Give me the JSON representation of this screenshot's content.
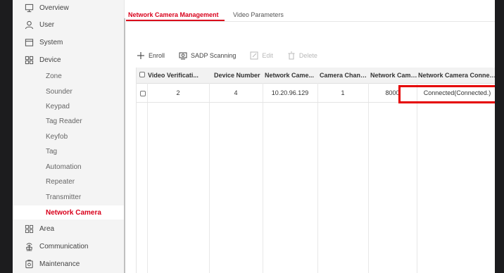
{
  "sidebar": {
    "top_items": [
      {
        "label": "Overview",
        "icon": "monitor-icon"
      },
      {
        "label": "User",
        "icon": "user-icon"
      },
      {
        "label": "System",
        "icon": "system-icon"
      },
      {
        "label": "Device",
        "icon": "device-icon"
      }
    ],
    "device_children": [
      "Zone",
      "Sounder",
      "Keypad",
      "Tag Reader",
      "Keyfob",
      "Tag",
      "Automation",
      "Repeater",
      "Transmitter",
      "Network Camera"
    ],
    "active_child": "Network Camera",
    "bottom_items": [
      {
        "label": "Area",
        "icon": "area-icon"
      },
      {
        "label": "Communication",
        "icon": "communication-icon"
      },
      {
        "label": "Maintenance",
        "icon": "maintenance-icon"
      }
    ]
  },
  "tabs": {
    "management": "Network Camera Management",
    "video": "Video Parameters"
  },
  "toolbar": {
    "enroll": "Enroll",
    "sadp": "SADP Scanning",
    "edit": "Edit",
    "delete": "Delete"
  },
  "table": {
    "headers": [
      "Video Verificati...",
      "Device Number",
      "Network Came...",
      "Camera Chann...",
      "Network Came...",
      "Network Camera Connection ..."
    ],
    "rows": [
      [
        "2",
        "4",
        "10.20.96.129",
        "1",
        "8000",
        "Connected(Connected.)"
      ]
    ]
  },
  "colors": {
    "accent": "#d9001b",
    "highlight": "#e50000"
  }
}
